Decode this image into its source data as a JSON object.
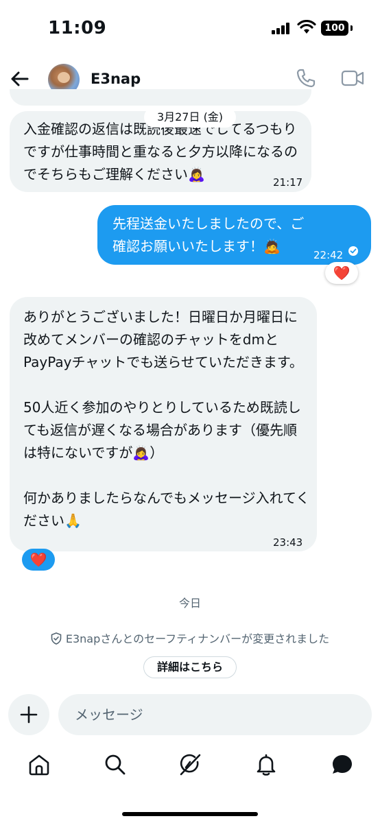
{
  "status_bar": {
    "time": "11:09",
    "battery": "100"
  },
  "header": {
    "contact_name": "E3nap"
  },
  "date_chip": "3月27日 (金)",
  "messages": [
    {
      "direction": "in",
      "text": "入金確認の返信は既読後最速でしてるつもりですが仕事時間と重なると夕方以降になるのでそちらもご理解ください🙇‍♀️",
      "time": "21:17"
    },
    {
      "direction": "out",
      "text": "先程送金いたしましたので、ご確認お願いいたします！🙇",
      "time": "22:42",
      "reaction": "❤️"
    },
    {
      "direction": "in",
      "text": "ありがとうございました！日曜日か月曜日に改めてメンバーの確認のチャットをdmとPayPayチャットでも送らせていただきます。\n\n50人近く参加のやりとりしているため既読しても返信が遅くなる場合があります（優先順は特にないですが🙇‍♀️）\n\n何かありましたらなんでもメッセージ入れてください🙏",
      "time": "23:43",
      "reaction": "❤️"
    }
  ],
  "today_label": "今日",
  "safety_notice": "E3napさんとのセーフティナンバーが変更されました",
  "details_button": "詳細はこちら",
  "composer": {
    "placeholder": "メッセージ"
  },
  "nav": [
    "home-icon",
    "search-icon",
    "grok-icon",
    "notifications-icon",
    "messages-icon"
  ],
  "colors": {
    "accent": "#1d9bf0",
    "incoming_bubble": "#eff3f4",
    "heart": "#f91880",
    "secondary_text": "#536471"
  }
}
